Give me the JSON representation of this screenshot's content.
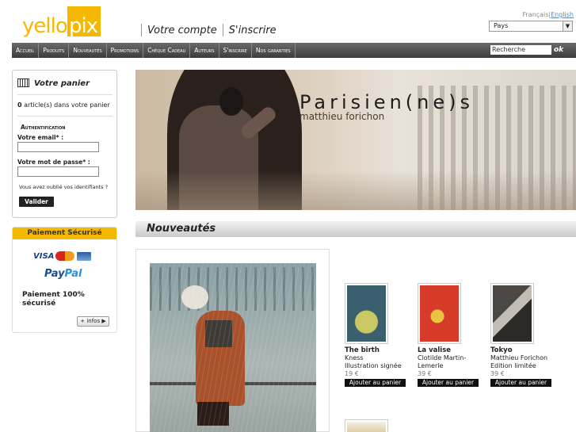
{
  "header": {
    "logo_left": "yello",
    "logo_right": "pix",
    "account_link": "Votre compte",
    "signup_link": "S'inscrire",
    "lang_fr": "Français|",
    "lang_en": "English",
    "country_select": "Pays"
  },
  "nav": {
    "items": [
      "Accueil",
      "Produits",
      "Nouveautés",
      "Promotions",
      "Chèque Cadeau",
      "Auteurs",
      "S'inscrire",
      "Nos garanties"
    ],
    "search_value": "Recherche",
    "search_ok": "ok"
  },
  "cart": {
    "title": "Votre panier",
    "count_number": "0",
    "count_text": " article(s) dans votre panier",
    "auth_title": "Authentification",
    "email_label": "Votre email* :",
    "password_label": "Votre mot de passe* :",
    "forgot": "Vous avez oublié vos identifiants ?",
    "validate": "Valider"
  },
  "payment": {
    "title": "Paiement Sécurisé",
    "visa": "VISA",
    "paypal_pay": "Pay",
    "paypal_pal": "Pal",
    "secure_text": "Paiement 100% sécurisé",
    "infos_button": "+ infos ▶"
  },
  "banner": {
    "title": "Parisien(ne)s",
    "subtitle": "matthieu forichon"
  },
  "section": {
    "title": "Nouveautés"
  },
  "products": [
    {
      "name": "The birth",
      "author": "Kness",
      "desc": "Illustration signée",
      "price": "19 €",
      "button": "Ajouter au panier"
    },
    {
      "name": "La valise",
      "author": "Clotilde Martin-Lemerle",
      "desc": "",
      "price": "39 €",
      "button": "Ajouter au panier"
    },
    {
      "name": "Tokyo",
      "author": "Matthieu Forichon",
      "desc": "Edition limitée",
      "price": "39 €",
      "button": "Ajouter au panier"
    }
  ],
  "colors": {
    "brand_yellow": "#f5b800",
    "nav_dark": "#3c3c3c",
    "button_black": "#111111"
  }
}
